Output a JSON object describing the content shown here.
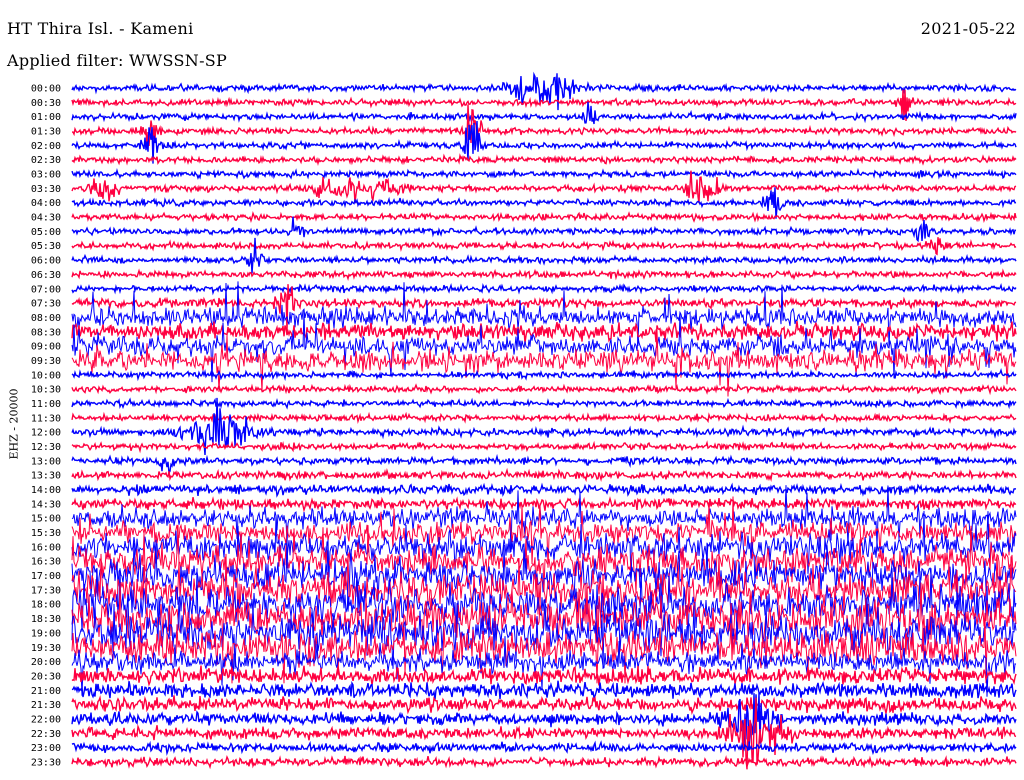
{
  "header": {
    "station": "HT Thira Isl. - Kameni",
    "date": "2021-05-22",
    "filter": "Applied filter: WWSSN-SP"
  },
  "axis": {
    "channel_label": "EHZ - 20000"
  },
  "colors": {
    "even_trace": "#0000ff",
    "odd_trace": "#ff0040",
    "background": "#ffffff"
  },
  "chart_data": {
    "type": "line",
    "title": "HT Thira Isl. - Kameni",
    "subtitle": "Applied filter: WWSSN-SP",
    "date": "2021-05-22",
    "ylabel": "EHZ - 20000",
    "y_tick_labels": [
      "00:00",
      "00:30",
      "01:00",
      "01:30",
      "02:00",
      "02:30",
      "03:00",
      "03:30",
      "04:00",
      "04:30",
      "05:00",
      "05:30",
      "06:00",
      "06:30",
      "07:00",
      "07:30",
      "08:00",
      "08:30",
      "09:00",
      "09:30",
      "10:00",
      "10:30",
      "11:00",
      "11:30",
      "12:00",
      "12:30",
      "13:00",
      "13:30",
      "14:00",
      "14:30",
      "15:00",
      "15:30",
      "16:00",
      "16:30",
      "17:00",
      "17:30",
      "18:00",
      "18:30",
      "19:00",
      "19:30",
      "20:00",
      "20:30",
      "21:00",
      "21:30",
      "22:00",
      "22:30",
      "23:00",
      "23:30"
    ],
    "trace_minutes": 30,
    "trace_colors": [
      "#0000ff",
      "#ff0040"
    ],
    "grid": false,
    "amplitude_levels": [
      1,
      1,
      1,
      1,
      1,
      1,
      1,
      1,
      1,
      1,
      1,
      1,
      1,
      1,
      1,
      1.4,
      3,
      2.6,
      3.2,
      3.4,
      1,
      1,
      1,
      1,
      1.2,
      1,
      1.1,
      1.2,
      1.5,
      1.6,
      3.2,
      3.6,
      4.2,
      4.5,
      4.8,
      5.2,
      5.6,
      5.8,
      5.6,
      5.2,
      3.2,
      2.6,
      2.4,
      2.2,
      2,
      1.8,
      1.4,
      1.4
    ],
    "events": [
      {
        "trace": "00:00",
        "minute": 15,
        "amplitude": 2.2,
        "duration_min": 2
      },
      {
        "trace": "00:30",
        "minute": 26.5,
        "amplitude": 1.6,
        "duration_min": 0.3
      },
      {
        "trace": "01:00",
        "minute": 16.5,
        "amplitude": 1.5,
        "duration_min": 0.3
      },
      {
        "trace": "01:30",
        "minute": 2.5,
        "amplitude": 2.2,
        "duration_min": 0.3
      },
      {
        "trace": "01:30",
        "minute": 12.7,
        "amplitude": 2.3,
        "duration_min": 0.3
      },
      {
        "trace": "02:00",
        "minute": 2.5,
        "amplitude": 2.6,
        "duration_min": 0.4
      },
      {
        "trace": "02:00",
        "minute": 12.7,
        "amplitude": 2.6,
        "duration_min": 0.4
      },
      {
        "trace": "03:30",
        "minute": 1,
        "amplitude": 1.4,
        "duration_min": 1
      },
      {
        "trace": "03:30",
        "minute": 9,
        "amplitude": 1.3,
        "duration_min": 3
      },
      {
        "trace": "03:30",
        "minute": 20,
        "amplitude": 1.7,
        "duration_min": 1.2
      },
      {
        "trace": "04:00",
        "minute": 22.3,
        "amplitude": 2.2,
        "duration_min": 0.4
      },
      {
        "trace": "05:00",
        "minute": 7.2,
        "amplitude": 1.5,
        "duration_min": 0.3
      },
      {
        "trace": "05:00",
        "minute": 27,
        "amplitude": 1.5,
        "duration_min": 0.3
      },
      {
        "trace": "05:30",
        "minute": 27.5,
        "amplitude": 1.4,
        "duration_min": 0.3
      },
      {
        "trace": "06:00",
        "minute": 5.8,
        "amplitude": 1.7,
        "duration_min": 0.3
      },
      {
        "trace": "07:30",
        "minute": 6.8,
        "amplitude": 2.2,
        "duration_min": 0.6
      },
      {
        "trace": "12:00",
        "minute": 4.6,
        "amplitude": 2.3,
        "duration_min": 2
      },
      {
        "trace": "13:00",
        "minute": 3,
        "amplitude": 1.3,
        "duration_min": 0.3
      },
      {
        "trace": "22:00",
        "minute": 21.5,
        "amplitude": 3.2,
        "duration_min": 1.5
      },
      {
        "trace": "22:30",
        "minute": 21.8,
        "amplitude": 3.6,
        "duration_min": 1.8
      }
    ]
  }
}
